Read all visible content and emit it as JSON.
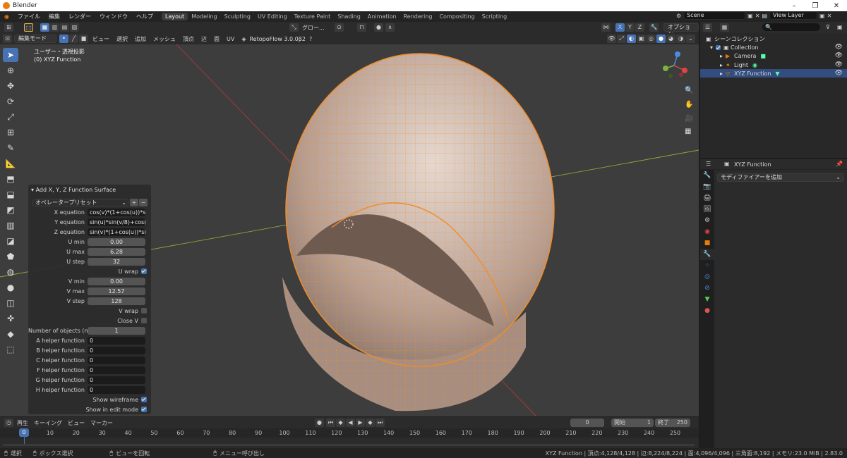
{
  "window": {
    "title": "Blender",
    "min": "–",
    "max": "❐",
    "close": "✕"
  },
  "menu": [
    "ファイル",
    "編集",
    "レンダー",
    "ウィンドウ",
    "ヘルプ"
  ],
  "workspaces": [
    "Layout",
    "Modeling",
    "Sculpting",
    "UV Editing",
    "Texture Paint",
    "Shading",
    "Animation",
    "Rendering",
    "Compositing",
    "Scripting"
  ],
  "active_workspace": "Layout",
  "scene": {
    "name": "Scene",
    "view_layer": "View Layer"
  },
  "vp_header": {
    "orientation": "グロー...",
    "mode": "編集モード",
    "menus": [
      "ビュー",
      "選択",
      "追加",
      "メッシュ",
      "頂点",
      "辺",
      "面",
      "UV"
    ],
    "addon": "RetopoFlow 3.0.0β2",
    "options": "オプション",
    "axes": [
      "X",
      "Y",
      "Z"
    ]
  },
  "viewport": {
    "view_name": "ユーザー・透視投影",
    "object_name": "(0) XYZ Function"
  },
  "operator": {
    "title": "Add X, Y, Z Function Surface",
    "preset": "オペレータープリセット",
    "rows": [
      {
        "label": "X equation",
        "value": "cos(v)*(1+cos(u))*sin..."
      },
      {
        "label": "Y equation",
        "value": "sin(u)*sin(v/8)+cos(v/..."
      },
      {
        "label": "Z equation",
        "value": "sin(v)*(1+cos(u))*sin(..."
      },
      {
        "label": "U min",
        "value": "0.00"
      },
      {
        "label": "U max",
        "value": "6.28"
      },
      {
        "label": "U step",
        "value": "32"
      }
    ],
    "u_wrap": "U wrap",
    "rows_v": [
      {
        "label": "V min",
        "value": "0.00"
      },
      {
        "label": "V max",
        "value": "12.57"
      },
      {
        "label": "V step",
        "value": "128"
      }
    ],
    "v_wrap": "V wrap",
    "close_v": "Close V",
    "num_objects": {
      "label": "Number of objects (n=...",
      "value": "1"
    },
    "helpers": [
      {
        "label": "A helper function",
        "value": "0"
      },
      {
        "label": "B helper function",
        "value": "0"
      },
      {
        "label": "C helper function",
        "value": "0"
      },
      {
        "label": "F helper function",
        "value": "0"
      },
      {
        "label": "G helper function",
        "value": "0"
      },
      {
        "label": "H helper function",
        "value": "0"
      }
    ],
    "show_wireframe": "Show wireframe",
    "show_in_edit": "Show in edit mode"
  },
  "outliner": {
    "root": "シーンコレクション",
    "collection": "Collection",
    "items": [
      "Camera",
      "Light",
      "XYZ Function"
    ]
  },
  "properties": {
    "object": "XYZ Function",
    "add_modifier": "モディファイアーを追加"
  },
  "timeline": {
    "menus": [
      "再生",
      "キーイング",
      "ビュー",
      "マーカー"
    ],
    "current": "0",
    "start_label": "開始",
    "start": "1",
    "end_label": "終了",
    "end": "250",
    "ticks": [
      "0",
      "10",
      "20",
      "30",
      "40",
      "50",
      "60",
      "70",
      "80",
      "90",
      "100",
      "110",
      "120",
      "130",
      "140",
      "150",
      "160",
      "170",
      "180",
      "190",
      "200",
      "210",
      "220",
      "230",
      "240",
      "250"
    ]
  },
  "status": {
    "select": "選択",
    "box_select": "ボックス選択",
    "rotate": "ビューを回転",
    "menu_call": "メニュー呼び出し",
    "stats": "XYZ Function | 頂点:4,128/4,128 | 辺:8,224/8,224 | 面:4,096/4,096 | 三角面:8,192 | メモリ:23.0 MiB | 2.83.0"
  },
  "colors": {
    "accent": "#4772b3",
    "selected_row": "#334d80",
    "mesh_orange": "#f08c28",
    "surface": "#b49a8a"
  }
}
